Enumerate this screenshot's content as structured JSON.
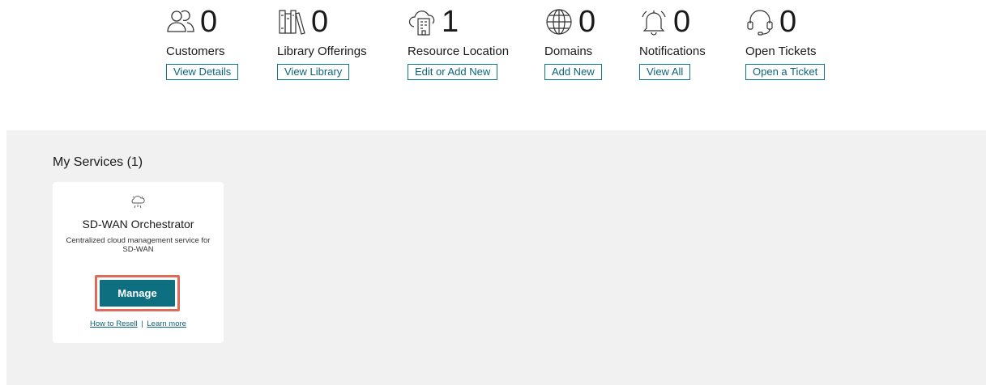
{
  "stats": [
    {
      "icon": "customers-icon",
      "count": "0",
      "label": "Customers",
      "button": "View Details"
    },
    {
      "icon": "library-icon",
      "count": "0",
      "label": "Library Offerings",
      "button": "View Library"
    },
    {
      "icon": "resource-location-icon",
      "count": "1",
      "label": "Resource Location",
      "button": "Edit or Add New"
    },
    {
      "icon": "globe-icon",
      "count": "0",
      "label": "Domains",
      "button": "Add New"
    },
    {
      "icon": "bell-icon",
      "count": "0",
      "label": "Notifications",
      "button": "View All"
    },
    {
      "icon": "headset-icon",
      "count": "0",
      "label": "Open Tickets",
      "button": "Open a Ticket"
    }
  ],
  "services": {
    "title": "My Services (1)",
    "cards": [
      {
        "icon": "sdwan-cloud-icon",
        "title": "SD-WAN Orchestrator",
        "description": "Centralized cloud management service for SD-WAN",
        "manage_label": "Manage",
        "link_resell": "How to Resell",
        "link_separator": "|",
        "link_learn": "Learn more"
      }
    ]
  },
  "colors": {
    "accent": "#0d6f80",
    "highlight": "#e06a5a",
    "panel_bg": "#f1f1f1"
  }
}
